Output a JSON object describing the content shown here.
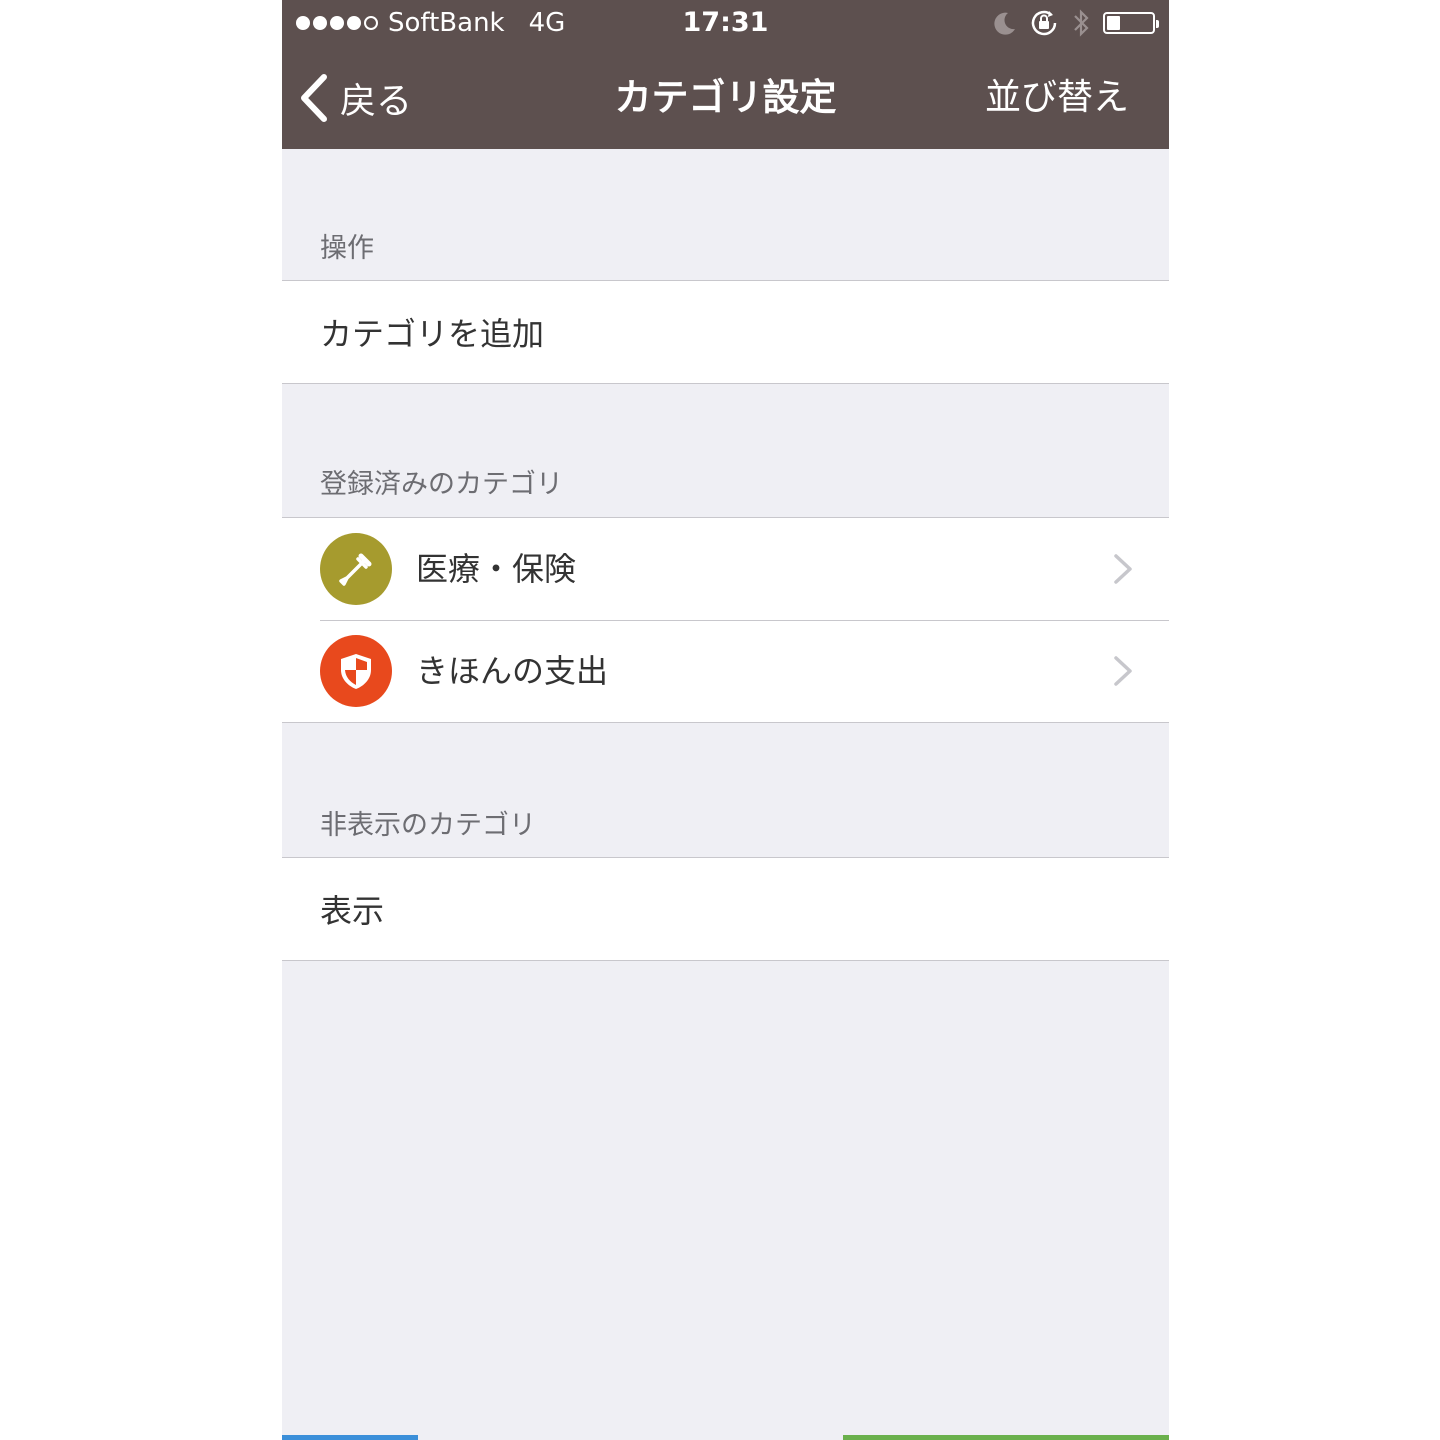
{
  "status_bar": {
    "carrier": "SoftBank",
    "network": "4G",
    "time": "17:31",
    "signal_bars_filled": 4,
    "signal_bars_total": 5,
    "battery_level": 0.3
  },
  "nav": {
    "back_label": "戻る",
    "title": "カテゴリ設定",
    "right_label": "並び替え"
  },
  "sections": {
    "operations": {
      "header": "操作",
      "add_category_label": "カテゴリを追加"
    },
    "registered": {
      "header": "登録済みのカテゴリ",
      "items": [
        {
          "label": "医療・保険",
          "icon": "dropper-icon",
          "color": "#a69b2e"
        },
        {
          "label": "きほんの支出",
          "icon": "shield-icon",
          "color": "#e8491d"
        }
      ]
    },
    "hidden": {
      "header": "非表示のカテゴリ",
      "show_label": "表示"
    }
  },
  "colors": {
    "nav_background": "#5d504f",
    "page_background": "#efeff4",
    "accent_left": "#3b8fd9",
    "accent_right": "#6ab04c"
  }
}
